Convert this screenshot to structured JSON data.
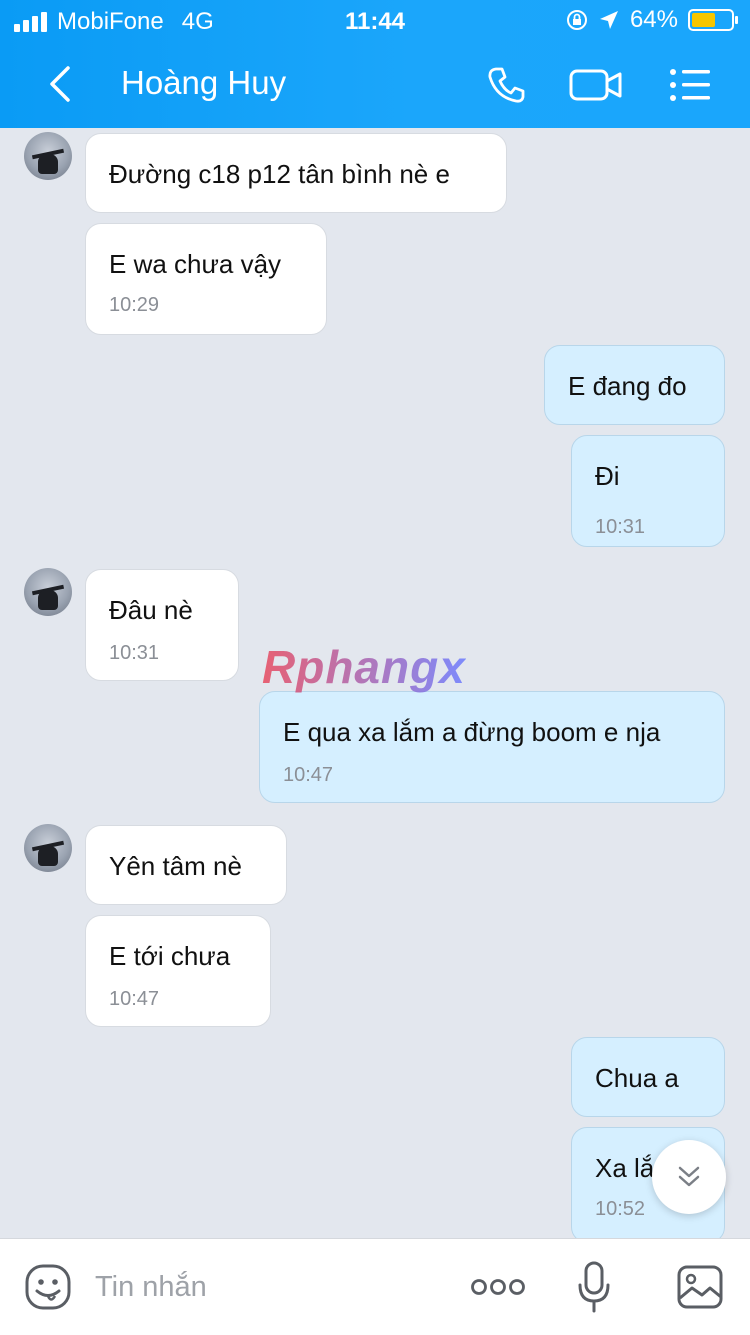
{
  "status_bar": {
    "carrier": "MobiFone",
    "network": "4G",
    "time": "11:44",
    "battery": "64%",
    "battery_level": 0.64
  },
  "header": {
    "title": "Hoàng Huy",
    "icons": [
      "back-icon",
      "phone-icon",
      "video-icon",
      "menu-icon"
    ]
  },
  "messages": [
    {
      "sender": "them",
      "text": "Đường c18 p12 tân bình nè e",
      "time": ""
    },
    {
      "sender": "them",
      "text": "E wa chưa vậy",
      "time": "10:29"
    },
    {
      "sender": "me",
      "text": "E đang đo",
      "time": ""
    },
    {
      "sender": "me",
      "text": "Đi",
      "time": "10:31"
    },
    {
      "sender": "them",
      "text": "Đâu nè",
      "time": "10:31"
    },
    {
      "sender": "me",
      "text": "E qua xa lắm a đừng boom e nja",
      "time": "10:47"
    },
    {
      "sender": "them",
      "text": "Yên tâm nè",
      "time": ""
    },
    {
      "sender": "them",
      "text": "E tới chưa",
      "time": "10:47"
    },
    {
      "sender": "me",
      "text": "Chua a",
      "time": ""
    },
    {
      "sender": "me",
      "text": "Xa lắ",
      "time": "10:52"
    }
  ],
  "watermark": "Rphangx",
  "composer": {
    "placeholder": "Tin nhắn",
    "icons": [
      "emoji-icon",
      "more-icon",
      "mic-icon",
      "image-icon"
    ]
  },
  "colors": {
    "header": "#1aa6fc",
    "incoming_bubble": "#ffffff",
    "outgoing_bubble": "#d5efff",
    "background": "#e3e7ee"
  }
}
